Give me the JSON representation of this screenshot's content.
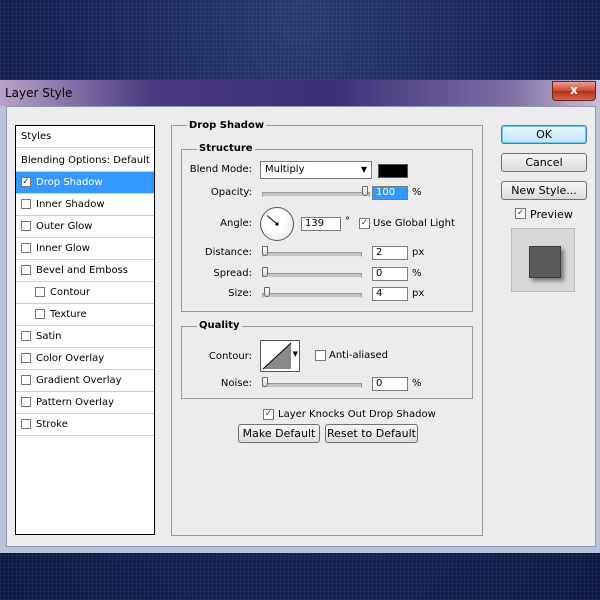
{
  "window": {
    "title": "Layer Style",
    "close_glyph": "x"
  },
  "sidebar": {
    "header": "Styles",
    "items": [
      {
        "label": "Blending Options: Default",
        "has_checkbox": false,
        "checked": false,
        "selected": false,
        "indent": 0
      },
      {
        "label": "Drop Shadow",
        "has_checkbox": true,
        "checked": true,
        "selected": true,
        "indent": 0
      },
      {
        "label": "Inner Shadow",
        "has_checkbox": true,
        "checked": false,
        "selected": false,
        "indent": 0
      },
      {
        "label": "Outer Glow",
        "has_checkbox": true,
        "checked": false,
        "selected": false,
        "indent": 0
      },
      {
        "label": "Inner Glow",
        "has_checkbox": true,
        "checked": false,
        "selected": false,
        "indent": 0
      },
      {
        "label": "Bevel and Emboss",
        "has_checkbox": true,
        "checked": false,
        "selected": false,
        "indent": 0
      },
      {
        "label": "Contour",
        "has_checkbox": true,
        "checked": false,
        "selected": false,
        "indent": 1
      },
      {
        "label": "Texture",
        "has_checkbox": true,
        "checked": false,
        "selected": false,
        "indent": 1
      },
      {
        "label": "Satin",
        "has_checkbox": true,
        "checked": false,
        "selected": false,
        "indent": 0
      },
      {
        "label": "Color Overlay",
        "has_checkbox": true,
        "checked": false,
        "selected": false,
        "indent": 0
      },
      {
        "label": "Gradient Overlay",
        "has_checkbox": true,
        "checked": false,
        "selected": false,
        "indent": 0
      },
      {
        "label": "Pattern Overlay",
        "has_checkbox": true,
        "checked": false,
        "selected": false,
        "indent": 0
      },
      {
        "label": "Stroke",
        "has_checkbox": true,
        "checked": false,
        "selected": false,
        "indent": 0
      }
    ]
  },
  "drop_shadow": {
    "title": "Drop Shadow",
    "structure": {
      "title": "Structure",
      "blend_mode_label": "Blend Mode:",
      "blend_mode_value": "Multiply",
      "shadow_color": "#000000",
      "opacity_label": "Opacity:",
      "opacity_value": "100",
      "opacity_unit": "%",
      "opacity_fraction": 1.0,
      "angle_label": "Angle:",
      "angle_value": "139",
      "angle_unit": "°",
      "use_global_light_label": "Use Global Light",
      "use_global_light_checked": true,
      "distance_label": "Distance:",
      "distance_value": "2",
      "distance_unit": "px",
      "distance_fraction": 0.0,
      "spread_label": "Spread:",
      "spread_value": "0",
      "spread_unit": "%",
      "spread_fraction": 0.0,
      "size_label": "Size:",
      "size_value": "4",
      "size_unit": "px",
      "size_fraction": 0.02
    },
    "quality": {
      "title": "Quality",
      "contour_label": "Contour:",
      "anti_aliased_label": "Anti-aliased",
      "anti_aliased_checked": false,
      "noise_label": "Noise:",
      "noise_value": "0",
      "noise_unit": "%",
      "noise_fraction": 0.0
    },
    "knocks_out_label": "Layer Knocks Out Drop Shadow",
    "knocks_out_checked": true,
    "make_default_label": "Make Default",
    "reset_default_label": "Reset to Default"
  },
  "actions": {
    "ok_label": "OK",
    "cancel_label": "Cancel",
    "new_style_label": "New Style...",
    "preview_label": "Preview",
    "preview_checked": true
  },
  "colors": {
    "selection": "#3399ff",
    "accent_text": "#1a3b80"
  },
  "checkmark_glyph": "✓"
}
